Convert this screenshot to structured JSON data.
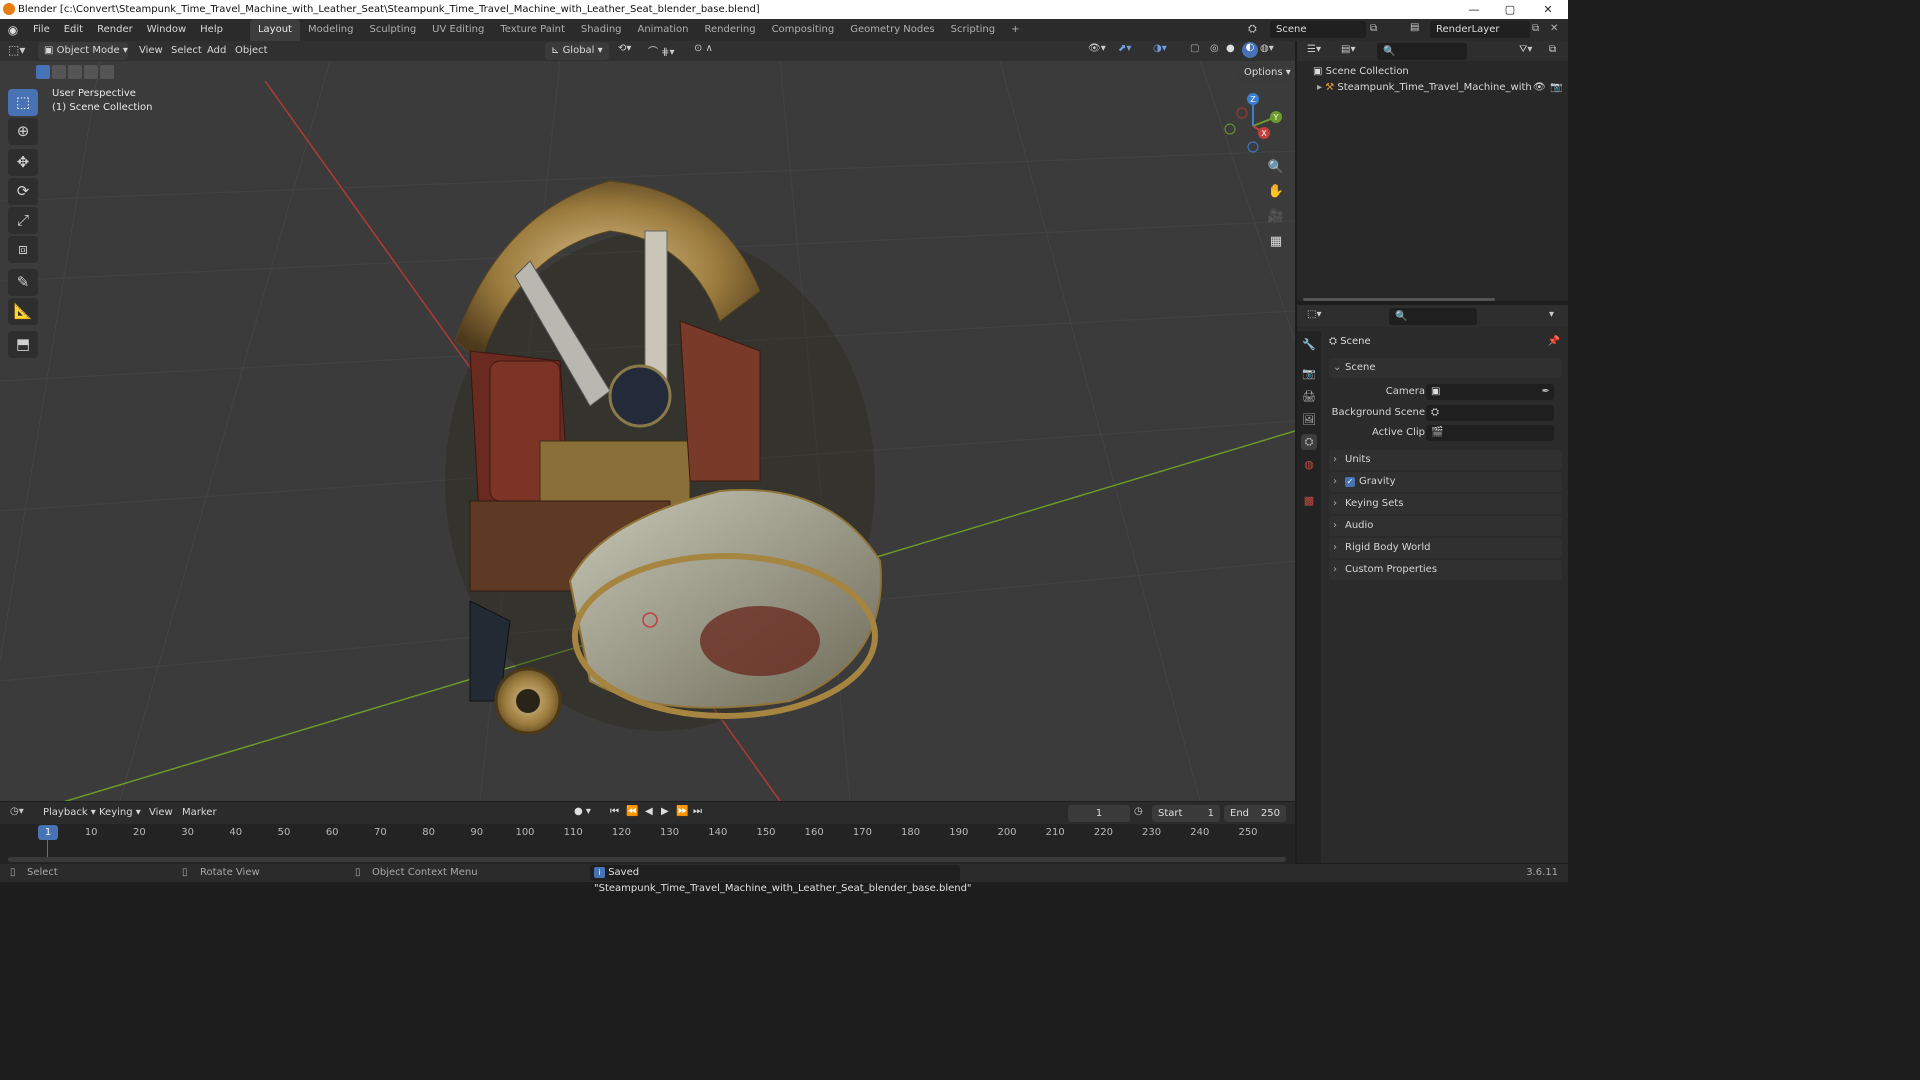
{
  "window": {
    "title": "Blender [c:\\Convert\\Steampunk_Time_Travel_Machine_with_Leather_Seat\\Steampunk_Time_Travel_Machine_with_Leather_Seat_blender_base.blend]",
    "controls": [
      "—",
      "▢",
      "✕"
    ]
  },
  "menubar": {
    "items": [
      "File",
      "Edit",
      "Render",
      "Window",
      "Help"
    ],
    "workspaces": [
      "Layout",
      "Modeling",
      "Sculpting",
      "UV Editing",
      "Texture Paint",
      "Shading",
      "Animation",
      "Rendering",
      "Compositing",
      "Geometry Nodes",
      "Scripting"
    ],
    "add_workspace": "+",
    "scene_label": "Scene",
    "viewlayer_label": "RenderLayer"
  },
  "viewport_header": {
    "mode": "Object Mode",
    "menus": [
      "View",
      "Select",
      "Add",
      "Object"
    ],
    "orientation": "Global",
    "options_label": "Options"
  },
  "viewport": {
    "overlay_line1": "User Perspective",
    "overlay_line2": "(1) Scene Collection",
    "gizmo_axes": [
      "X",
      "Y",
      "Z"
    ]
  },
  "toolbar": {
    "icons": [
      "select-box-icon",
      "cursor-icon",
      "move-icon",
      "rotate-icon",
      "scale-icon",
      "transform-icon",
      "annotate-icon",
      "measure-icon",
      "add-cube-icon"
    ],
    "active_index": 0
  },
  "outliner": {
    "root": "Scene Collection",
    "items": [
      {
        "name": "Steampunk_Time_Travel_Machine_with"
      }
    ]
  },
  "properties": {
    "header_title": "Scene",
    "section_title": "Scene",
    "fields": [
      {
        "label": "Camera",
        "value": ""
      },
      {
        "label": "Background Scene",
        "value": ""
      },
      {
        "label": "Active Clip",
        "value": ""
      }
    ],
    "panels": [
      "Units",
      "Gravity",
      "Keying Sets",
      "Audio",
      "Rigid Body World",
      "Custom Properties"
    ],
    "gravity_checked": true
  },
  "timeline": {
    "menus": [
      "Playback",
      "Keying",
      "View",
      "Marker"
    ],
    "current_frame": "1",
    "start_label": "Start",
    "start_value": "1",
    "end_label": "End",
    "end_value": "250",
    "ticks": [
      "10",
      "20",
      "30",
      "40",
      "50",
      "60",
      "70",
      "80",
      "90",
      "100",
      "110",
      "120",
      "130",
      "140",
      "150",
      "160",
      "170",
      "180",
      "190",
      "200",
      "210",
      "220",
      "230",
      "240",
      "250"
    ],
    "playhead_label": "1"
  },
  "statusbar": {
    "select": "Select",
    "rotate": "Rotate View",
    "context": "Object Context Menu",
    "message": "Saved \"Steampunk_Time_Travel_Machine_with_Leather_Seat_blender_base.blend\"",
    "version": "3.6.11"
  },
  "colors": {
    "accent": "#4772b3",
    "x_axis": "#c0403c",
    "y_axis": "#6b9b2b",
    "z_axis": "#3c7fd0"
  }
}
